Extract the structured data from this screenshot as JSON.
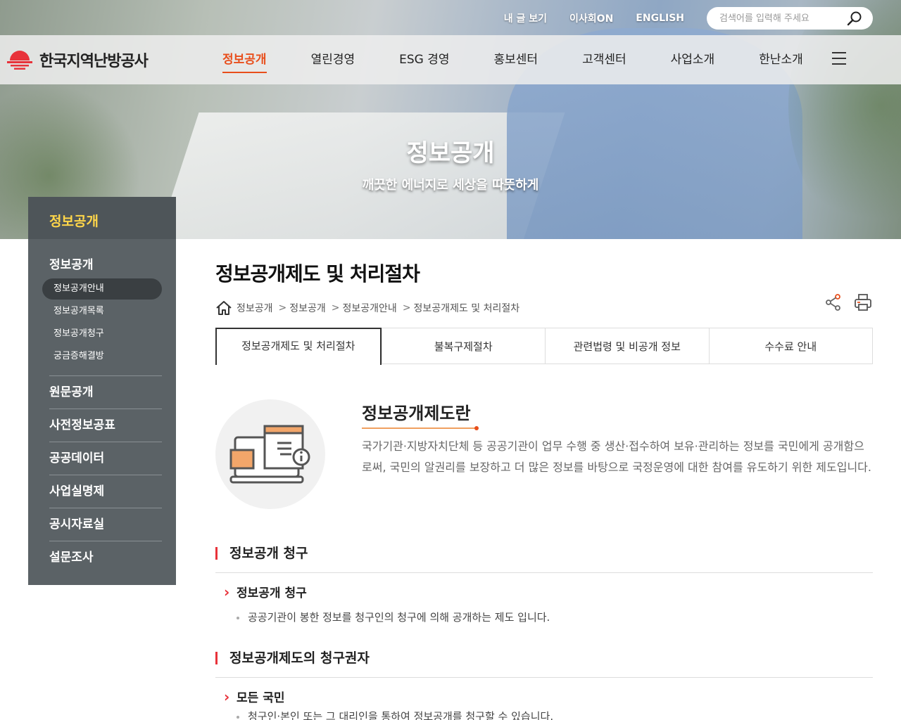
{
  "hero": {
    "title": "정보공개",
    "subtitle": "깨끗한 에너지로 세상을 따뜻하게"
  },
  "util": {
    "links": [
      "내 글 보기",
      "이사회ON",
      "ENGLISH"
    ],
    "search_placeholder": "검색어를 입력해 주세요"
  },
  "logo": {
    "text": "한국지역난방공사"
  },
  "gnb": {
    "items": [
      "정보공개",
      "열린경영",
      "ESG 경영",
      "홍보센터",
      "고객센터",
      "사업소개",
      "한난소개"
    ]
  },
  "lnb": {
    "head": "정보공개",
    "section_title": "정보공개",
    "sub_items": [
      "정보공개안내",
      "정보공개목록",
      "정보공개청구",
      "궁금증해결방"
    ],
    "items": [
      "원문공개",
      "사전정보공표",
      "공공데이터",
      "사업실명제",
      "공시자료실",
      "설문조사"
    ]
  },
  "content": {
    "page_title": "정보공개제도 및 처리절차",
    "breadcrumb": [
      "정보공개",
      "정보공개",
      "정보공개안내",
      "정보공개제도 및 처리절차"
    ],
    "tabs": [
      "정보공개제도 및 처리절차",
      "불복구제절차",
      "관련법령 및 비공개 정보",
      "수수료 안내"
    ],
    "intro": {
      "title": "정보공개제도란",
      "text": "국가기관·지방자치단체 등 공공기관이 업무 수행 중 생산·접수하여 보유·관리하는 정보를 국민에게 공개함으로써, 국민의 알권리를 보장하고 더 많은 정보를 바탕으로 국정운영에 대한 참여를 유도하기 위한 제도입니다."
    },
    "sections": [
      {
        "heading": "정보공개 청구",
        "sub_heading": "정보공개 청구",
        "bullet": "공공기관이 봉한 정보를 청구인의 청구에 의해 공개하는 제도 입니다."
      },
      {
        "heading": "정보공개제도의 청구권자",
        "sub_heading": "모든 국민",
        "bullet": "청구인·본인 또는 그 대리인을 통하여 정보공개를 청구할 수 있습니다."
      }
    ]
  },
  "colors": {
    "accent": "#e84e1b",
    "lnb_bg": "#5b6266",
    "lnb_highlight": "#ffd64a",
    "bar": "#e8323a"
  }
}
